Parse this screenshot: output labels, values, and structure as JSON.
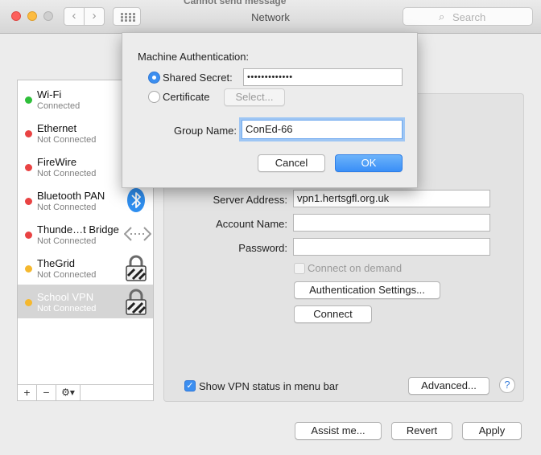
{
  "window": {
    "title": "Network",
    "behind_text": "Cannot send message",
    "search_placeholder": "Search"
  },
  "sidebar": {
    "items": [
      {
        "name": "Wi-Fi",
        "status": "Connected",
        "dot_color": "#2fbf3a",
        "icon": "none"
      },
      {
        "name": "Ethernet",
        "status": "Not Connected",
        "dot_color": "#e94343",
        "icon": "none"
      },
      {
        "name": "FireWire",
        "status": "Not Connected",
        "dot_color": "#e94343",
        "icon": "none"
      },
      {
        "name": "Bluetooth PAN",
        "status": "Not Connected",
        "dot_color": "#e94343",
        "icon": "bluetooth-icon"
      },
      {
        "name": "Thunde…t Bridge",
        "status": "Not Connected",
        "dot_color": "#e94343",
        "icon": "bridge-arrows-icon"
      },
      {
        "name": "TheGrid",
        "status": "Not Connected",
        "dot_color": "#f5b82e",
        "icon": "lock-icon"
      },
      {
        "name": "School VPN",
        "status": "Not Connected",
        "dot_color": "#f5b82e",
        "icon": "lock-icon",
        "selected": true
      }
    ],
    "toolbar": {
      "add": "+",
      "remove": "−",
      "gear": "⚙▾"
    }
  },
  "vpn": {
    "server_address_label": "Server Address:",
    "server_address_value": "vpn1.hertsgfl.org.uk",
    "account_name_label": "Account Name:",
    "account_name_value": "",
    "password_label": "Password:",
    "password_value": "",
    "connect_on_demand_label": "Connect on demand",
    "auth_settings_button": "Authentication Settings...",
    "connect_button": "Connect",
    "show_status_label": "Show VPN status in menu bar",
    "advanced_button": "Advanced...",
    "help_button": "?"
  },
  "footer": {
    "assist_button": "Assist me...",
    "revert_button": "Revert",
    "apply_button": "Apply"
  },
  "sheet": {
    "heading": "Machine Authentication:",
    "shared_secret_label": "Shared Secret:",
    "shared_secret_value": "•••••••••••••",
    "certificate_label": "Certificate",
    "select_button": "Select...",
    "group_name_label": "Group Name:",
    "group_name_value": "ConEd-66",
    "cancel_button": "Cancel",
    "ok_button": "OK"
  },
  "colors": {
    "accent": "#3b8ef0"
  }
}
